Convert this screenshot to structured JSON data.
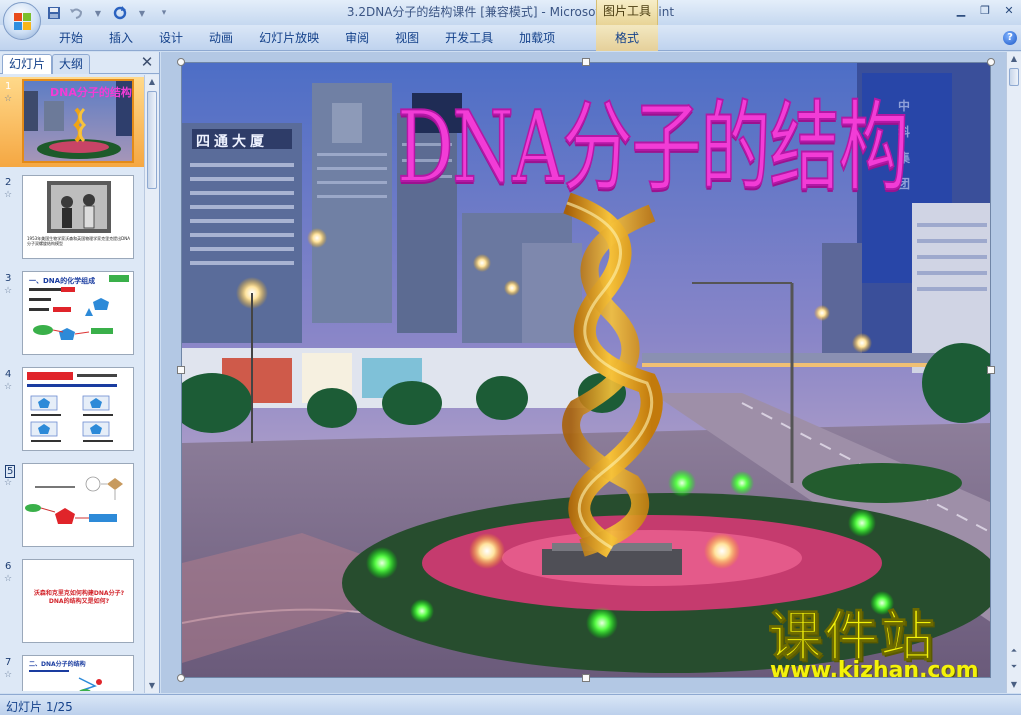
{
  "window": {
    "title": "3.2DNA分子的结构课件 [兼容模式] - Microsoft PowerPoint",
    "contextual_group": "图片工具"
  },
  "ribbon": {
    "tabs": [
      "开始",
      "插入",
      "设计",
      "动画",
      "幻灯片放映",
      "审阅",
      "视图",
      "开发工具",
      "加载项"
    ],
    "format_tab": "格式"
  },
  "pane": {
    "tab_slides": "幻灯片",
    "tab_outline": "大纲",
    "thumbnails": [
      {
        "num": "1",
        "title": "DNA分子的结构",
        "selected": true
      },
      {
        "num": "2",
        "caption": "1953年美国生物学家沃森和英国物理学家克里克提出DNA分子双螺旋结构模型"
      },
      {
        "num": "3",
        "heading": "一、DNA的化学组成"
      },
      {
        "num": "4"
      },
      {
        "num": "5"
      },
      {
        "num": "6",
        "text": "沃森和克里克如何构建DNA分子?DNA的结构又是如何?"
      },
      {
        "num": "7",
        "text": "二、DNA分子的结构"
      }
    ]
  },
  "slide": {
    "title": "DNA分子的结构",
    "watermark_cn": "课件站",
    "watermark_url": "www.kjzhan.com",
    "building_sign": "四通大厦",
    "tower_sign": "中科集团"
  },
  "status": {
    "slide_counter": "幻灯片 1/25"
  },
  "colors": {
    "title_magenta": "#f23cd6",
    "watermark_yellow": "#f4f20a",
    "selection_orange": "#f5a742"
  }
}
